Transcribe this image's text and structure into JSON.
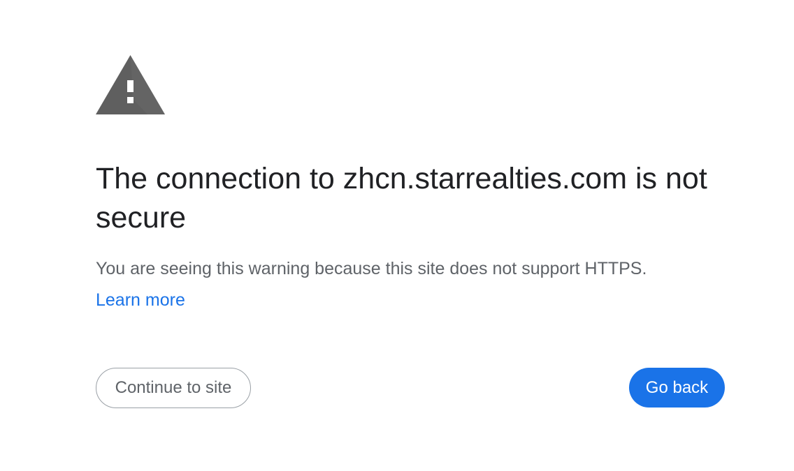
{
  "interstitial": {
    "title": "The connection to zhcn.starrealties.com is not secure",
    "message": "You are seeing this warning because this site does not support HTTPS.",
    "learn_more": "Learn more",
    "icon": "warning-triangle-icon"
  },
  "actions": {
    "continue_label": "Continue to site",
    "go_back_label": "Go back"
  },
  "colors": {
    "title": "#202124",
    "body": "#5f6368",
    "link": "#1a73e8",
    "primary_button": "#1a73e8",
    "icon": "#5f5f5f"
  }
}
